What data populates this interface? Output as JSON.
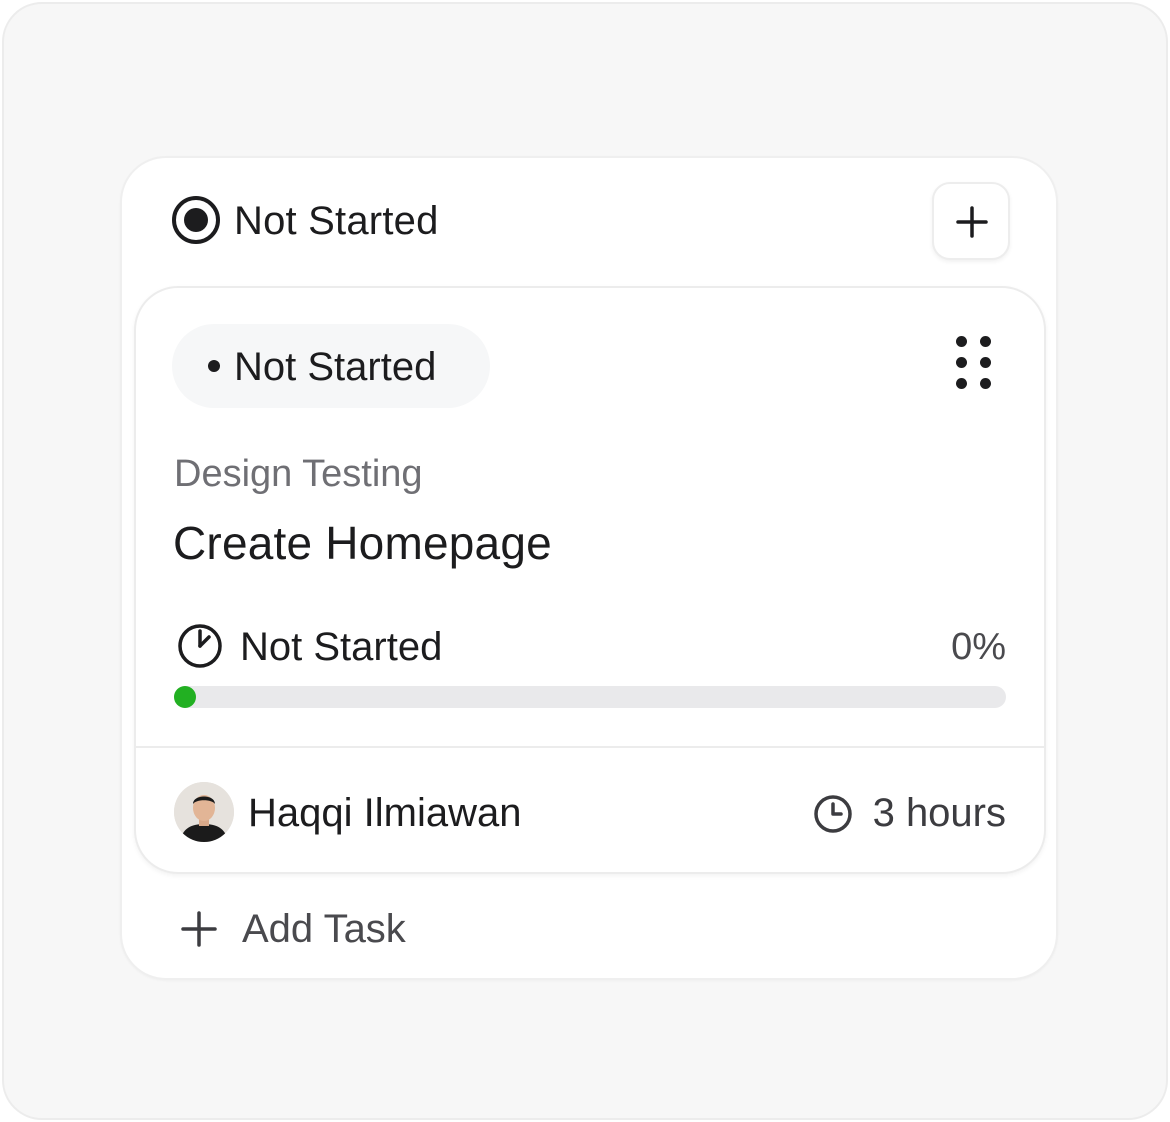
{
  "column": {
    "title": "Not Started",
    "add_button_icon": "plus-icon",
    "add_task_label": "Add Task"
  },
  "task": {
    "status_pill": "Not Started",
    "project": "Design Testing",
    "title": "Create Homepage",
    "progress": {
      "label": "Not Started",
      "percent_text": "0%",
      "fraction": 0.0
    },
    "assignee": {
      "name": "Haqqi Ilmiawan",
      "avatar_icon": "user-avatar"
    },
    "duration": "3 hours"
  },
  "colors": {
    "progress_accent": "#22b022",
    "text_primary": "#1c1c1e",
    "text_secondary": "#6f6f74",
    "pill_bg": "#f6f7f8",
    "track_bg": "#e9e9eb"
  },
  "icons": {
    "status": "radio-filled-icon",
    "drag": "drag-handle-icon",
    "progress": "progress-ring-icon",
    "time": "clock-icon",
    "add_task": "plus-icon"
  }
}
